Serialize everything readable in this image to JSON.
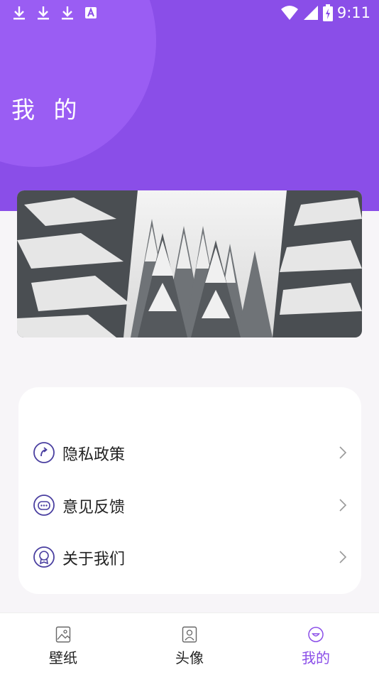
{
  "status_bar": {
    "time": "9:11",
    "left_icons": [
      "download-icon",
      "download-icon",
      "download-icon",
      "a-icon"
    ],
    "right_icons": [
      "wifi-icon",
      "signal-icon",
      "battery-charging-icon"
    ]
  },
  "header": {
    "title": "我 的",
    "background_color": "#8a4ee8",
    "accent_color": "#9a5df3"
  },
  "banner": {
    "image_description_icon": "snowy-forest-image"
  },
  "menu": {
    "items": [
      {
        "label": "隐私政策",
        "icon": "share-arrow-icon"
      },
      {
        "label": "意见反馈",
        "icon": "chat-bubble-icon"
      },
      {
        "label": "关于我们",
        "icon": "badge-icon"
      }
    ]
  },
  "tab_bar": {
    "tabs": [
      {
        "label": "壁纸",
        "icon": "picture-icon",
        "active": false
      },
      {
        "label": "头像",
        "icon": "portrait-icon",
        "active": false
      },
      {
        "label": "我的",
        "icon": "smile-icon",
        "active": true
      }
    ],
    "active_color": "#8a4ee8"
  }
}
